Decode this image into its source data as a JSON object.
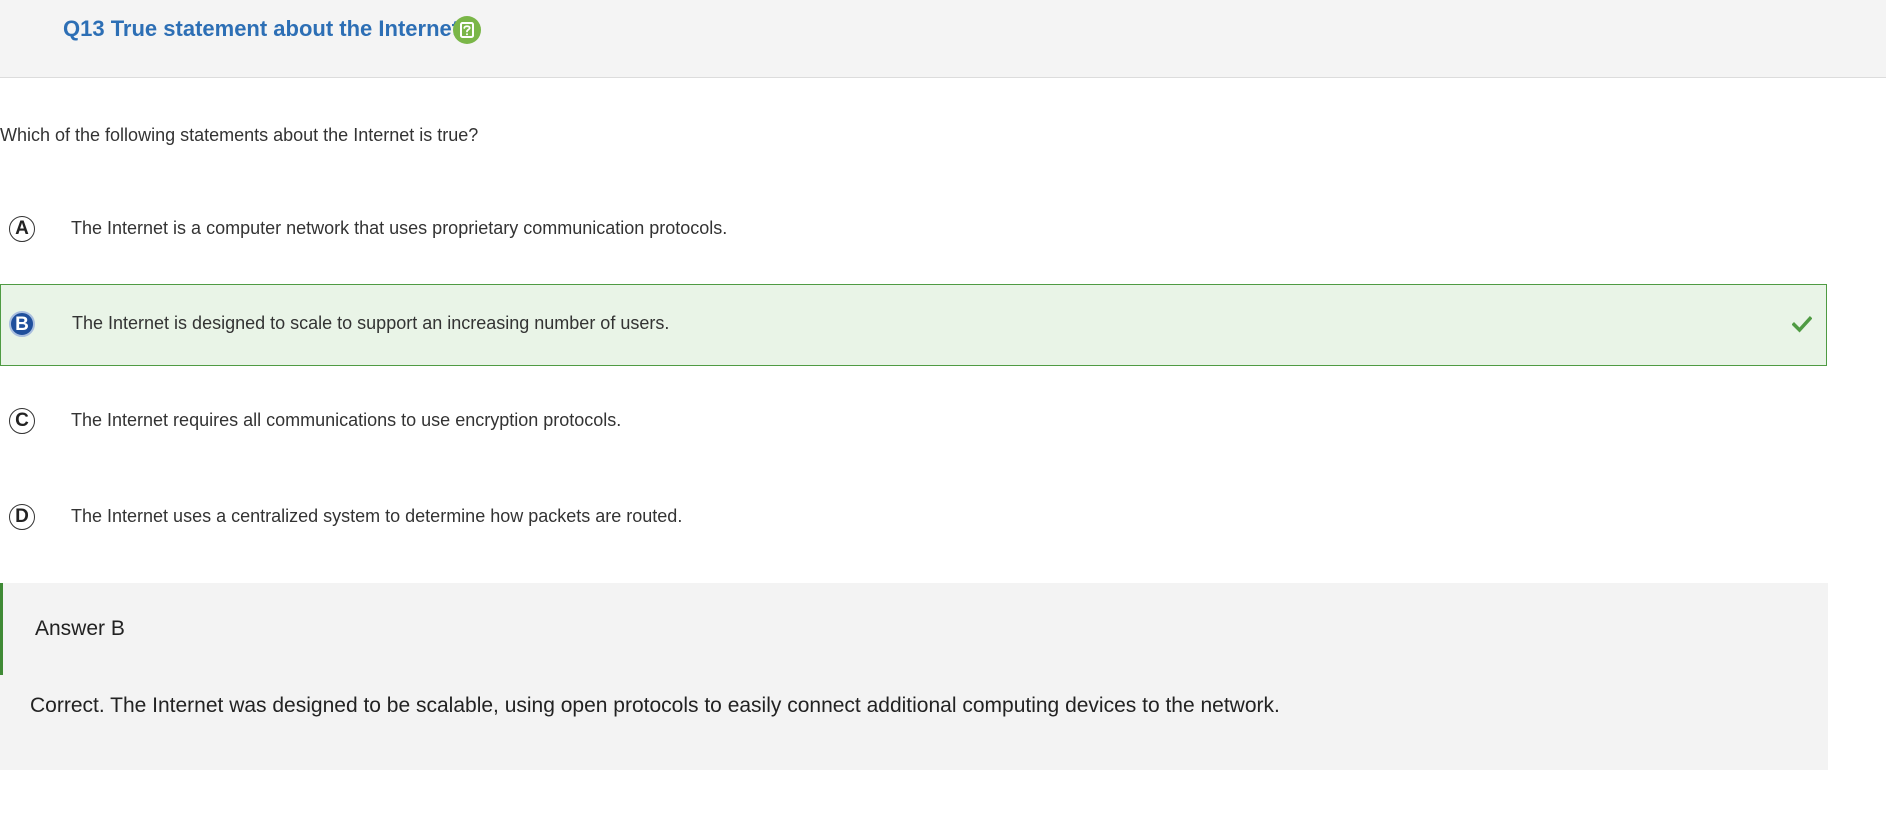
{
  "question": {
    "title": "Q13 True statement about the Internet",
    "help_icon": "help-question-icon",
    "prompt": "Which of the following statements about the Internet is true?"
  },
  "options": [
    {
      "letter": "A",
      "text": "The Internet is a computer network that uses proprietary communication protocols.",
      "selected": false,
      "correct": false
    },
    {
      "letter": "B",
      "text": "The Internet is designed to scale to support an increasing number of users.",
      "selected": true,
      "correct": true
    },
    {
      "letter": "C",
      "text": "The Internet requires all communications to use encryption protocols.",
      "selected": false,
      "correct": false
    },
    {
      "letter": "D",
      "text": "The Internet uses a centralized system to determine how packets are routed.",
      "selected": false,
      "correct": false
    }
  ],
  "answer": {
    "heading": "Answer B",
    "explanation": "Correct. The Internet was designed to be scalable, using open protocols to easily connect additional computing devices to the network."
  },
  "colors": {
    "title": "#2d6fb5",
    "help_icon": "#7ab648",
    "correct_background": "#e9f4e7",
    "correct_border": "#4f9b43",
    "selected_letter": "#1f4f9c",
    "check": "#4f9b43"
  }
}
